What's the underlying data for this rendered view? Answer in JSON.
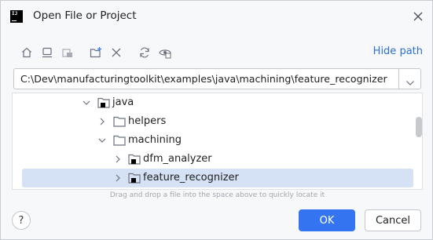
{
  "window": {
    "title": "Open File or Project",
    "app_icon_text": "IJ"
  },
  "toolbar": {
    "icons": [
      "home-icon",
      "desktop-icon",
      "project-folder-icon",
      "new-folder-icon",
      "delete-icon",
      "refresh-icon",
      "show-hidden-icon"
    ],
    "hide_path_label": "Hide path"
  },
  "path": {
    "value": "C:\\Dev\\manufacturingtoolkit\\examples\\java\\machining\\feature_recognizer"
  },
  "tree": {
    "rows": [
      {
        "label": "java",
        "expanded": true,
        "module": true,
        "selected": false
      },
      {
        "label": "helpers",
        "expanded": false,
        "module": false,
        "selected": false
      },
      {
        "label": "machining",
        "expanded": true,
        "module": false,
        "selected": false
      },
      {
        "label": "dfm_analyzer",
        "expanded": false,
        "module": true,
        "selected": false
      },
      {
        "label": "feature_recognizer",
        "expanded": false,
        "module": true,
        "selected": true
      }
    ]
  },
  "hint": "Drag and drop a file into the space above to quickly locate it",
  "buttons": {
    "help": "?",
    "ok": "OK",
    "cancel": "Cancel"
  },
  "colors": {
    "accent": "#3574f0",
    "link": "#2f6fd1",
    "selection": "#d5e1f5",
    "background": "#f7f8fa"
  }
}
